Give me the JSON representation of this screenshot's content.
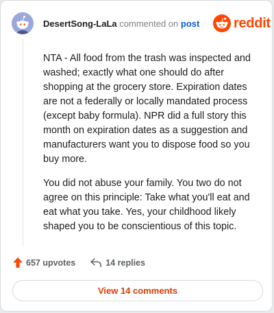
{
  "header": {
    "author": "DesertSong-LaLa",
    "action_text": "commented on",
    "post_link": "post"
  },
  "logo": {
    "wordmark": "reddit",
    "icon": "reddit-alien-icon",
    "brand_color": "#ff4500"
  },
  "comment": {
    "paragraphs": [
      "NTA - All food from the trash was inspected and washed; exactly what one should do after shopping at the grocery store. Expiration dates are not a federally or locally mandated process (except baby formula). NPR did a full story this month on expiration dates as a suggestion and manufacturers want you to dispose food so you buy more.",
      "You did not abuse your family. You two do not agree on this principle: Take what you'll eat and eat what you take. Yes, your childhood likely shaped you to be conscientious of this topic."
    ]
  },
  "stats": {
    "upvotes": "657 upvotes",
    "replies": "14 replies",
    "upvote_icon": "upvote-arrow-icon",
    "reply_icon": "reply-arrow-icon"
  },
  "footer": {
    "view_comments": "View 14 comments"
  }
}
